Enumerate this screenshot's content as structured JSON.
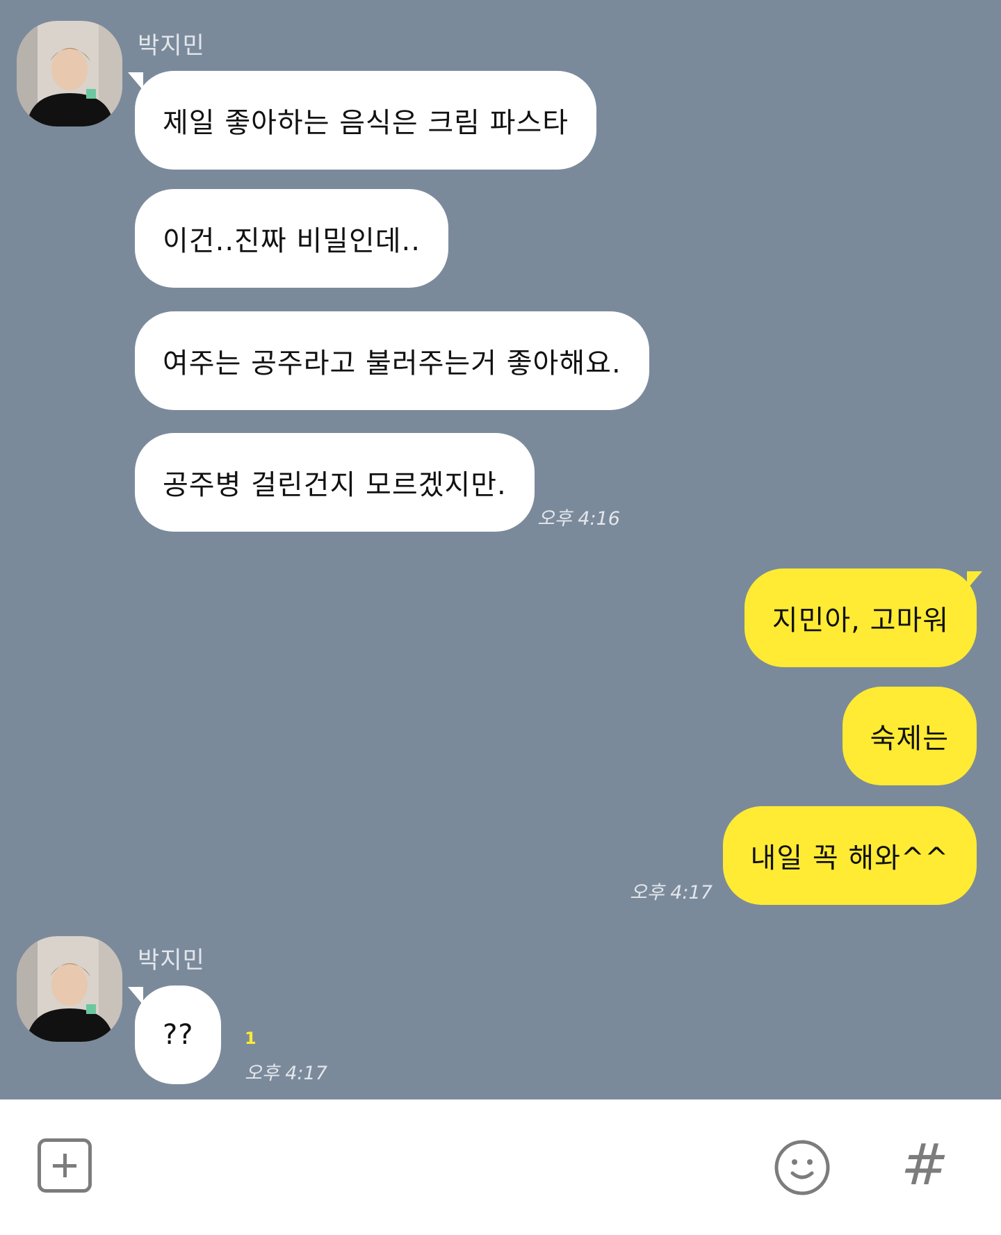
{
  "sender_name": "박지민",
  "group1": {
    "messages": [
      "제일 좋아하는 음식은 크림 파스타",
      "이건..진짜 비밀인데..",
      "여주는 공주라고 불러주는거 좋아해요.",
      "공주병 걸린건지 모르겠지만."
    ],
    "time": "오후 4:16"
  },
  "group2": {
    "messages": [
      "지민아, 고마워",
      "숙제는",
      "내일 꼭 해와^^"
    ],
    "time": "오후 4:17"
  },
  "group3": {
    "messages": [
      "??"
    ],
    "unread": "1",
    "time": "오후 4:17"
  },
  "input_bar": {
    "icons": [
      "plus-icon",
      "emoticon-icon",
      "hash-icon"
    ],
    "hash_glyph": "#"
  },
  "colors": {
    "background": "#7b8a9b",
    "incoming_bubble": "#ffffff",
    "outgoing_bubble": "#ffeb33",
    "input_bar": "#ffffff"
  }
}
